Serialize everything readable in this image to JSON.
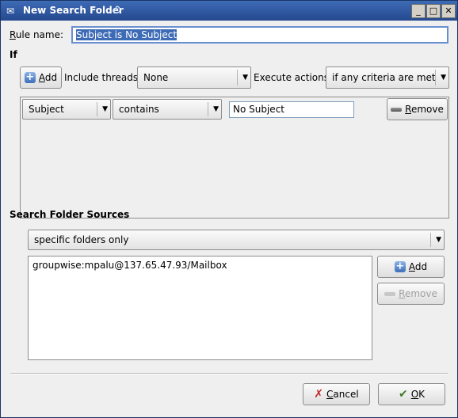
{
  "window": {
    "title": "New Search Folder",
    "icon": "envelope-icon"
  },
  "rule": {
    "label": "Rule name:",
    "value": "Subject is No Subject"
  },
  "if_label": "If",
  "criteria_bar": {
    "add_label": "Add",
    "include_threads_label": "Include threads",
    "include_threads_value": "None",
    "execute_actions_label": "Execute actions",
    "execute_actions_value": "if any criteria are met"
  },
  "criterion": {
    "field": "Subject",
    "operator": "contains",
    "value": "No Subject",
    "remove_label": "Remove"
  },
  "sources": {
    "heading": "Search Folder Sources",
    "scope": "specific folders only",
    "items": [
      "groupwise:mpalu@137.65.47.93/Mailbox"
    ],
    "add_label": "Add",
    "remove_label": "Remove"
  },
  "footer": {
    "cancel_label": "Cancel",
    "ok_label": "OK"
  }
}
